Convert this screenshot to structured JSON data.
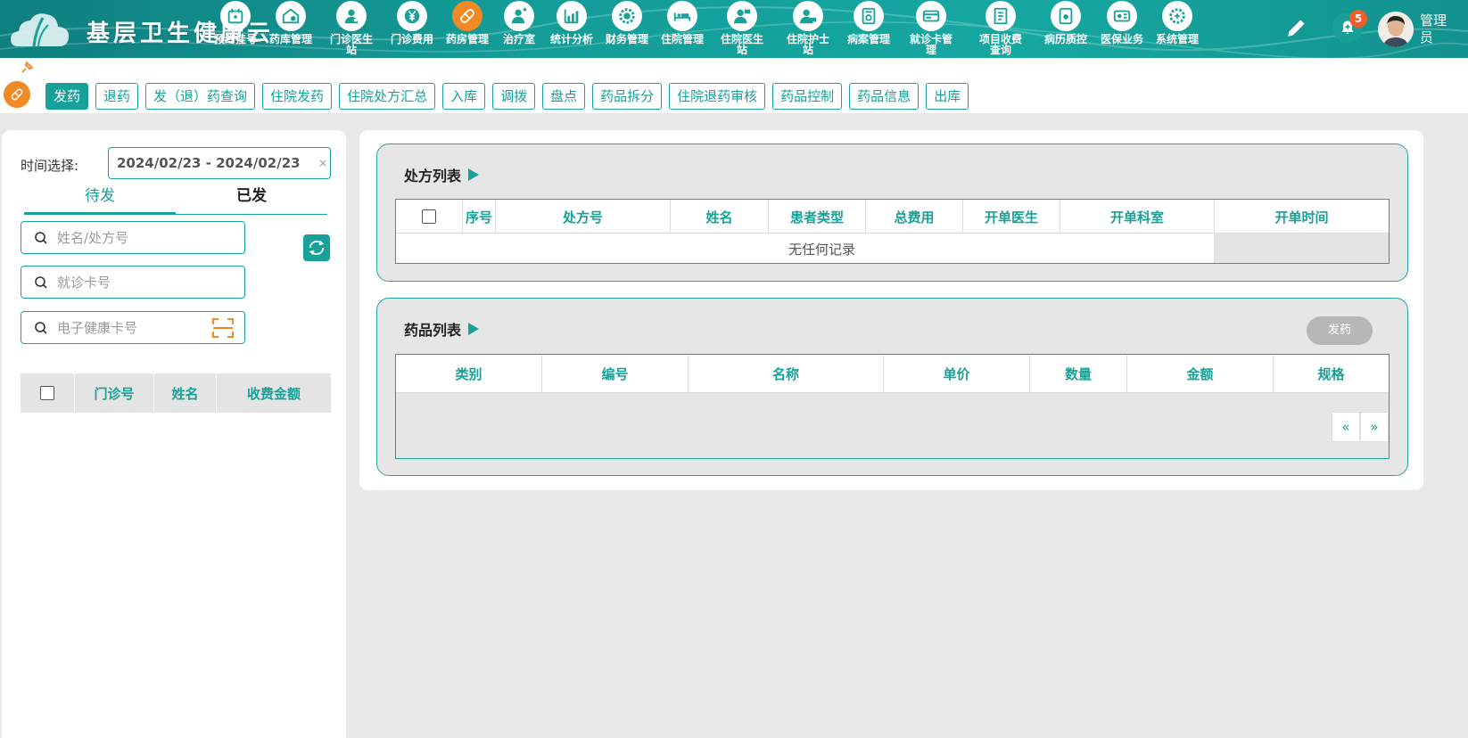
{
  "header": {
    "brand": "基层卫生健康云",
    "nav": [
      {
        "label": "预约挂号",
        "icon": "calendar-icon"
      },
      {
        "label": "药库管理",
        "icon": "warehouse-icon"
      },
      {
        "label": "门诊医生站",
        "icon": "doctor-icon"
      },
      {
        "label": "门诊费用",
        "icon": "yen-icon"
      },
      {
        "label": "药房管理",
        "icon": "pill-icon"
      },
      {
        "label": "治疗室",
        "icon": "nurse-icon"
      },
      {
        "label": "统计分析",
        "icon": "chart-icon"
      },
      {
        "label": "财务管理",
        "icon": "finance-icon"
      },
      {
        "label": "住院管理",
        "icon": "bed-icon"
      },
      {
        "label": "住院医生站",
        "icon": "inpatient-doctor-icon"
      },
      {
        "label": "住院护士站",
        "icon": "inpatient-nurse-icon"
      },
      {
        "label": "病案管理",
        "icon": "record-icon"
      },
      {
        "label": "就诊卡管理",
        "icon": "card-icon"
      },
      {
        "label": "项目收费查询",
        "icon": "fee-query-icon"
      },
      {
        "label": "病历质控",
        "icon": "quality-icon"
      },
      {
        "label": "医保业务",
        "icon": "insurance-icon"
      },
      {
        "label": "系统管理",
        "icon": "settings-icon"
      }
    ],
    "notification_count": "5",
    "user_name": "管理员"
  },
  "subnav": {
    "tabs": [
      "发药",
      "退药",
      "发（退）药查询",
      "住院发药",
      "住院处方汇总",
      "入库",
      "调拨",
      "盘点",
      "药品拆分",
      "住院退药审核",
      "药品控制",
      "药品信息",
      "出库"
    ],
    "active": "发药"
  },
  "left": {
    "date_label": "时间选择:",
    "date_range": "2024/02/23 - 2024/02/23",
    "clear_symbol": "×",
    "tab_pending": "待发",
    "tab_done": "已发",
    "search_name_placeholder": "姓名/处方号",
    "search_card_placeholder": "就诊卡号",
    "search_health_placeholder": "电子健康卡号",
    "columns": [
      "门诊号",
      "姓名",
      "收费金额"
    ]
  },
  "prescriptions": {
    "title": "处方列表",
    "columns": [
      "序号",
      "处方号",
      "姓名",
      "患者类型",
      "总费用",
      "开单医生",
      "开单科室",
      "开单时间"
    ],
    "empty_text": "无任何记录"
  },
  "drugs": {
    "title": "药品列表",
    "dispense_button": "发药",
    "columns": [
      "类别",
      "编号",
      "名称",
      "单价",
      "数量",
      "金额",
      "规格"
    ],
    "pager_prev": "«",
    "pager_next": "»"
  },
  "colors": {
    "primary": "#17a199",
    "accent": "#f08a24",
    "badge": "#f25b2a"
  }
}
